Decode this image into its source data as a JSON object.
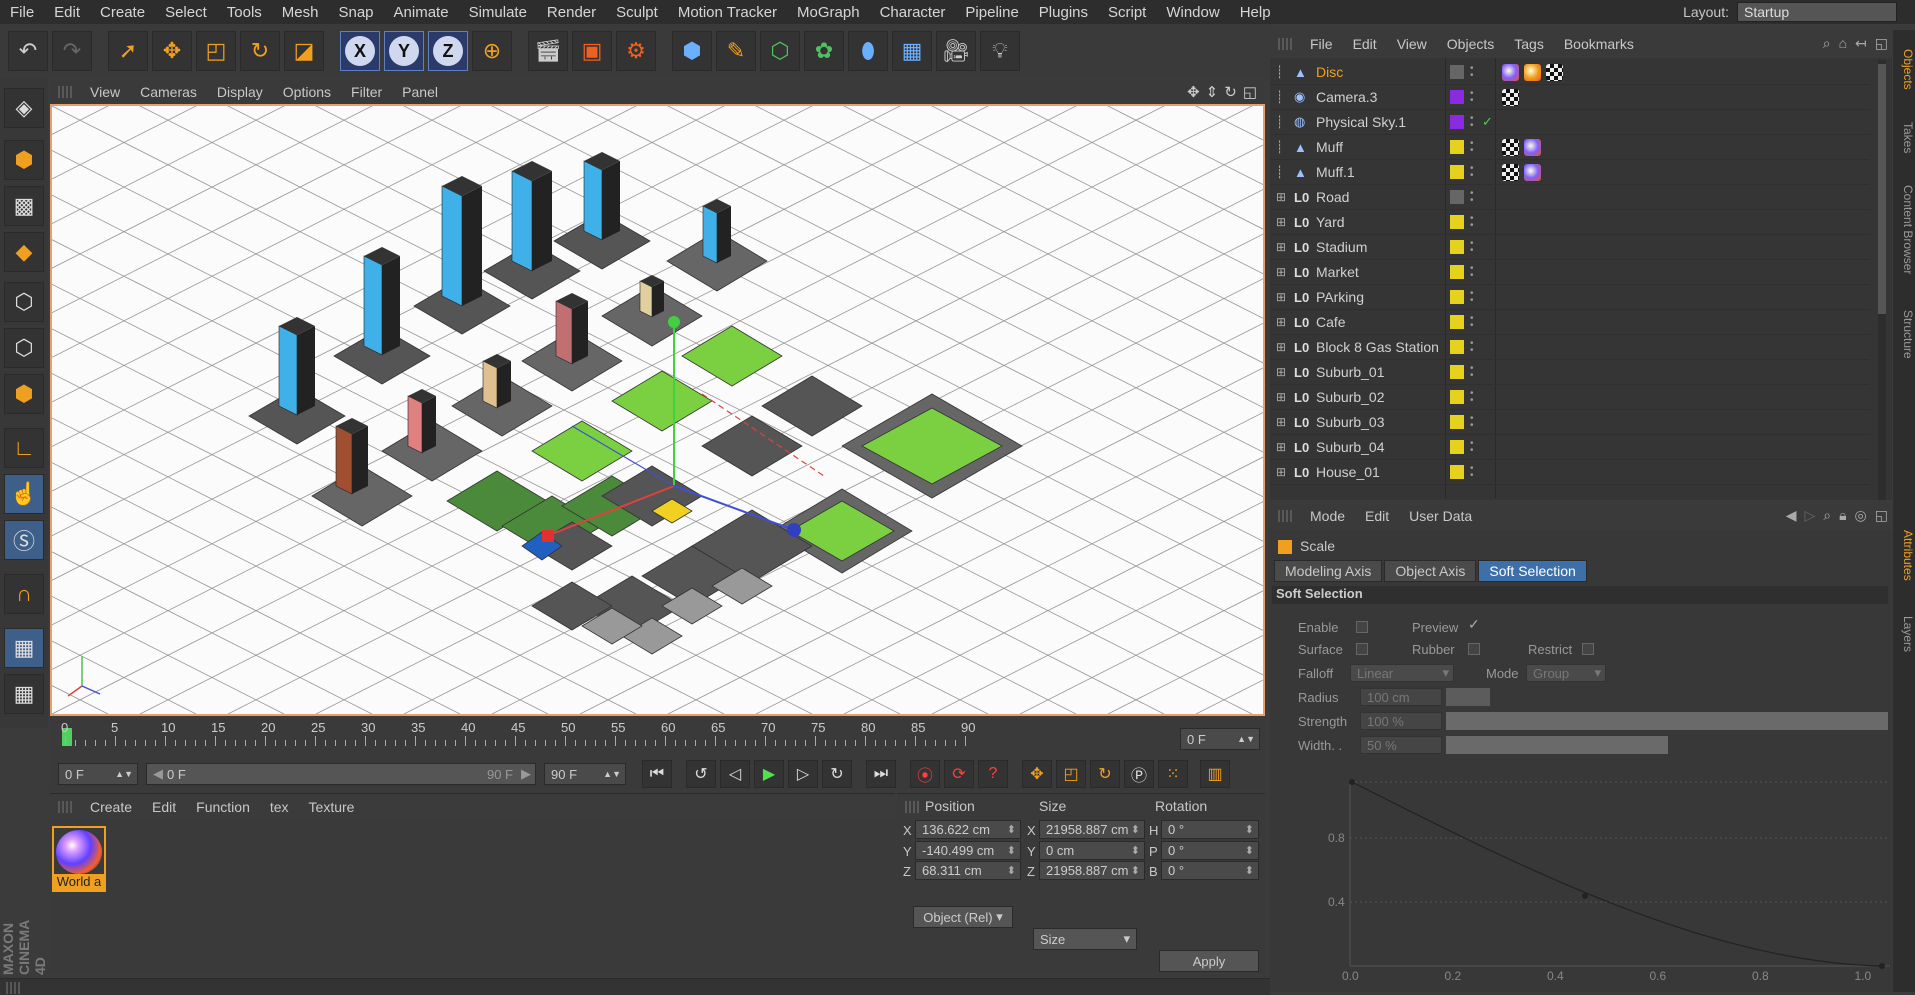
{
  "menubar": [
    "File",
    "Edit",
    "Create",
    "Select",
    "Tools",
    "Mesh",
    "Snap",
    "Animate",
    "Simulate",
    "Render",
    "Sculpt",
    "Motion Tracker",
    "MoGraph",
    "Character",
    "Pipeline",
    "Plugins",
    "Script",
    "Window",
    "Help"
  ],
  "layout": {
    "label": "Layout:",
    "value": "Startup"
  },
  "toolbar_icons": [
    "undo-icon",
    "redo-icon",
    "select-arrow-icon",
    "move-icon",
    "scale-icon",
    "rotate-icon",
    "recent-tool-icon",
    "x-axis-icon",
    "y-axis-icon",
    "z-axis-icon",
    "world-coords-icon",
    "render-view-icon",
    "render-picture-viewer-icon",
    "render-settings-icon",
    "cube-icon",
    "pen-icon",
    "subdivision-icon",
    "cloner-icon",
    "deformer-icon",
    "floor-icon",
    "camera-icon",
    "light-icon"
  ],
  "toolbar_axes": [
    "X",
    "Y",
    "Z"
  ],
  "viewport_menu": [
    "View",
    "Cameras",
    "Display",
    "Options",
    "Filter",
    "Panel"
  ],
  "timeline": {
    "ticks": [
      "0",
      "5",
      "10",
      "15",
      "20",
      "25",
      "30",
      "35",
      "40",
      "45",
      "50",
      "55",
      "60",
      "65",
      "70",
      "75",
      "80",
      "85",
      "90"
    ],
    "frame": "0 F"
  },
  "controls": {
    "current": "0 F",
    "range_start": "0 F",
    "range_end": "90 F",
    "end": "90 F"
  },
  "material_menu": [
    "Create",
    "Edit",
    "Function",
    "tex",
    "Texture"
  ],
  "material": {
    "label": "World a"
  },
  "coord_headers": {
    "position": "Position",
    "size": "Size",
    "rotation": "Rotation"
  },
  "coords": [
    {
      "axis": "X",
      "pos": "136.622 cm",
      "size_axis": "X",
      "size": "21958.887 cm",
      "rot_axis": "H",
      "rot": "0 °"
    },
    {
      "axis": "Y",
      "pos": "-140.499 cm",
      "size_axis": "Y",
      "size": "0 cm",
      "rot_axis": "P",
      "rot": "0 °"
    },
    {
      "axis": "Z",
      "pos": "68.311 cm",
      "size_axis": "Z",
      "size": "21958.887 cm",
      "rot_axis": "B",
      "rot": "0 °"
    }
  ],
  "coord_controls": {
    "mode": "Object (Rel)",
    "size_mode": "Size",
    "apply": "Apply"
  },
  "object_menu": [
    "File",
    "Edit",
    "View",
    "Objects",
    "Tags",
    "Bookmarks"
  ],
  "objects": [
    {
      "name": "Disc",
      "icon": "▲",
      "color": "#666666",
      "active": true
    },
    {
      "name": "Camera.3",
      "icon": "◉",
      "color": "#8a2be2"
    },
    {
      "name": "Physical Sky.1",
      "icon": "◍",
      "color": "#8a2be2"
    },
    {
      "name": "Muff",
      "icon": "▲",
      "color": "#e6d21e"
    },
    {
      "name": "Muff.1",
      "icon": "▲",
      "color": "#e6d21e"
    },
    {
      "name": "Road",
      "icon": "L0",
      "color": "#666666"
    },
    {
      "name": "Yard",
      "icon": "L0",
      "color": "#e6d21e"
    },
    {
      "name": "Stadium",
      "icon": "L0",
      "color": "#e6d21e"
    },
    {
      "name": "Market",
      "icon": "L0",
      "color": "#e6d21e"
    },
    {
      "name": "PArking",
      "icon": "L0",
      "color": "#e6d21e"
    },
    {
      "name": "Cafe",
      "icon": "L0",
      "color": "#e6d21e"
    },
    {
      "name": "Block 8 Gas Station",
      "icon": "L0",
      "color": "#e6d21e"
    },
    {
      "name": "Suburb_01",
      "icon": "L0",
      "color": "#e6d21e"
    },
    {
      "name": "Suburb_02",
      "icon": "L0",
      "color": "#e6d21e"
    },
    {
      "name": "Suburb_03",
      "icon": "L0",
      "color": "#e6d21e"
    },
    {
      "name": "Suburb_04",
      "icon": "L0",
      "color": "#e6d21e"
    },
    {
      "name": "House_01",
      "icon": "L0",
      "color": "#e6d21e"
    }
  ],
  "attr_menu": [
    "Mode",
    "Edit",
    "User Data"
  ],
  "attr": {
    "tool": "Scale",
    "tabs": [
      "Modeling Axis",
      "Object Axis",
      "Soft Selection"
    ],
    "section": "Soft Selection",
    "enable": "Enable",
    "preview": "Preview",
    "surface": "Surface",
    "rubber": "Rubber",
    "restrict": "Restrict",
    "falloff": "Falloff",
    "falloff_val": "Linear",
    "mode": "Mode",
    "mode_val": "Group",
    "radius": "Radius",
    "radius_val": "100 cm",
    "strength": "Strength",
    "strength_val": "100 %",
    "width": "Width. .",
    "width_val": "50 %",
    "graph_y": [
      "0.8",
      "0.4"
    ],
    "graph_x": [
      "0.0",
      "0.2",
      "0.4",
      "0.6",
      "0.8",
      "1.0"
    ]
  },
  "right_tabs": [
    "Objects",
    "Takes",
    "Content Browser",
    "Structure",
    "Attributes",
    "Layers"
  ],
  "brand": "MAXON CINEMA 4D"
}
